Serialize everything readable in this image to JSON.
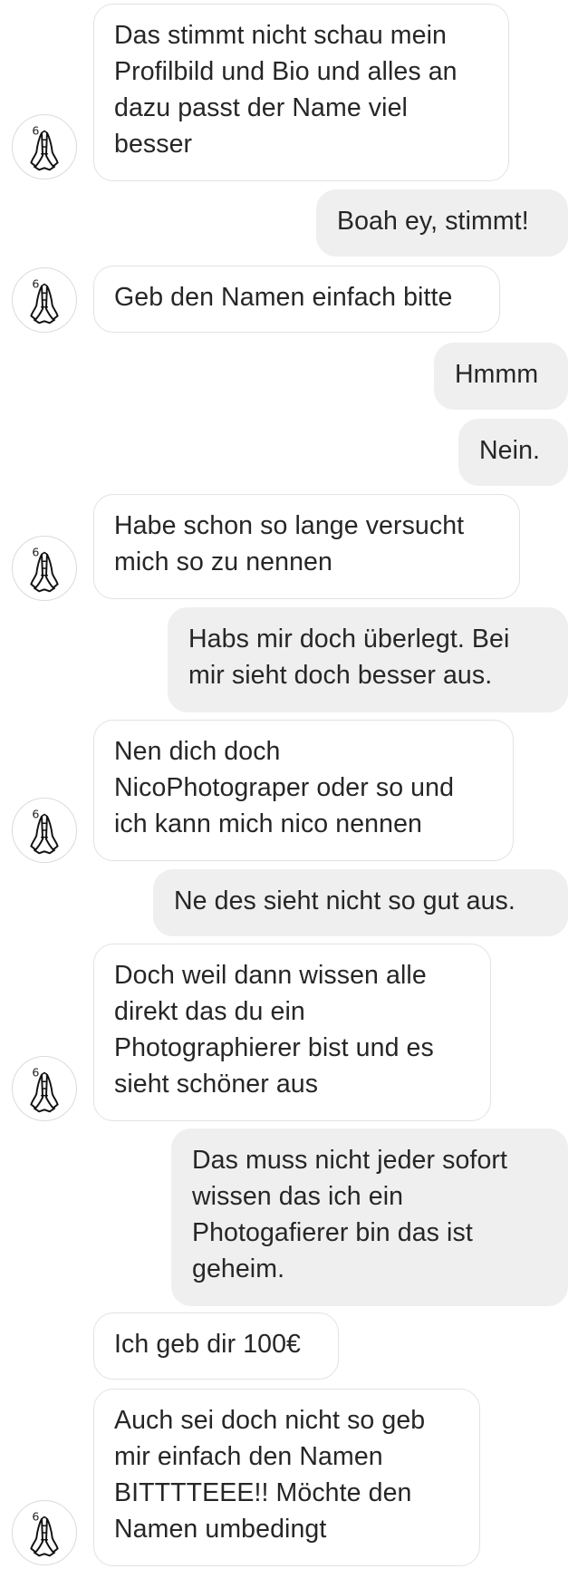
{
  "conversation": {
    "messages": [
      {
        "dir": "in",
        "text": "Das stimmt nicht schau mein\nProfilbild und Bio und alles an\ndazu passt der Name viel\nbesser",
        "avatar": true
      },
      {
        "dir": "out",
        "text": "Boah ey, stimmt!"
      },
      {
        "dir": "in",
        "text": "Geb den Namen einfach bitte",
        "avatar": true
      },
      {
        "dir": "out",
        "text": "Hmmm"
      },
      {
        "dir": "out",
        "text": "Nein."
      },
      {
        "dir": "in",
        "text": "Habe schon so lange versucht\nmich so zu nennen",
        "avatar": true
      },
      {
        "dir": "out",
        "text": "Habs mir doch überlegt. Bei\nmir sieht doch besser aus."
      },
      {
        "dir": "in",
        "text": "Nen dich doch\nNicoPhotograper oder so und\nich kann mich nico nennen",
        "avatar": true
      },
      {
        "dir": "out",
        "text": "Ne des sieht nicht so gut aus."
      },
      {
        "dir": "in",
        "text": "Doch weil dann wissen alle\ndirekt das du ein\nPhotographierer bist und es\nsieht schöner aus",
        "avatar": true
      },
      {
        "dir": "out",
        "text": "Das muss nicht jeder sofort\nwissen das ich ein\nPhotogafierer bin das ist\ngeheim."
      },
      {
        "dir": "in",
        "text": "Ich geb dir 100€",
        "avatar": false
      },
      {
        "dir": "in",
        "text": "Auch sei doch nicht so geb\nmir einfach den Namen\nBITTTTEEE!! Möchte den\nNamen umbedingt",
        "avatar": true
      }
    ]
  },
  "avatar": {
    "icon": "praying-hands-icon",
    "badge": "6"
  },
  "colors": {
    "incoming_bg": "#ffffff",
    "incoming_border": "#e2e2e2",
    "outgoing_bg": "#efefef",
    "text": "#262626"
  }
}
